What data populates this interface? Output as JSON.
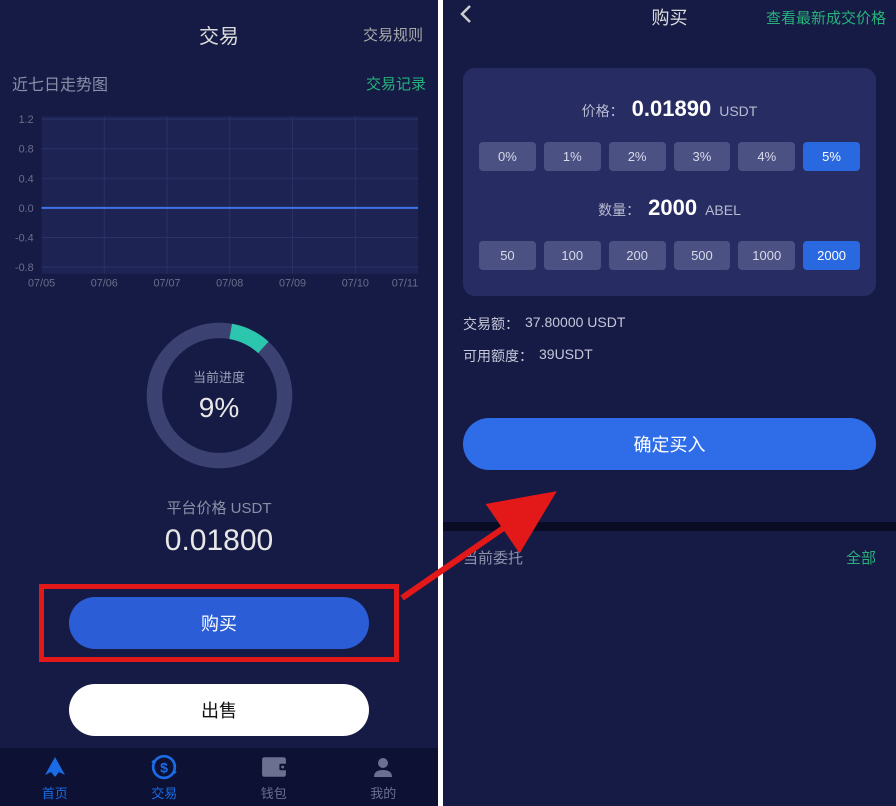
{
  "left": {
    "header": {
      "title": "交易",
      "rules": "交易规则"
    },
    "subheader": {
      "trend_label": "近七日走势图",
      "records": "交易记录"
    },
    "donut": {
      "label": "当前进度",
      "value": "9%"
    },
    "price": {
      "label": "平台价格 USDT",
      "value": "0.01800"
    },
    "buttons": {
      "buy": "购买",
      "sell": "出售"
    },
    "tabs": [
      "首页",
      "交易",
      "钱包",
      "我的"
    ]
  },
  "right": {
    "header": {
      "title": "购买",
      "link": "查看最新成交价格"
    },
    "price": {
      "label": "价格：",
      "value": "0.01890",
      "unit": "USDT"
    },
    "pct_options": [
      "0%",
      "1%",
      "2%",
      "3%",
      "4%",
      "5%"
    ],
    "pct_selected": 5,
    "qty": {
      "label": "数量：",
      "value": "2000",
      "unit": "ABEL"
    },
    "qty_options": [
      "50",
      "100",
      "200",
      "500",
      "1000",
      "2000"
    ],
    "qty_selected": 5,
    "info": {
      "amount_label": "交易额：",
      "amount_value": "37.80000 USDT",
      "balance_label": "可用额度：",
      "balance_value": "39USDT"
    },
    "confirm": "确定买入",
    "orders": {
      "title": "当前委托",
      "link": "全部"
    }
  },
  "chart_data": {
    "type": "line",
    "title": "近七日走势图",
    "x": [
      "07/05",
      "07/06",
      "07/07",
      "07/08",
      "07/09",
      "07/10",
      "07/11"
    ],
    "y_ticks": [
      -0.8,
      -0.4,
      0.0,
      0.4,
      0.8,
      1.2
    ],
    "values": [
      0,
      0,
      0,
      0,
      0,
      0,
      0
    ],
    "ylim": [
      -0.8,
      1.2
    ]
  },
  "donut_data": {
    "type": "pie",
    "values": [
      9,
      91
    ],
    "labels": [
      "progress",
      "remaining"
    ]
  }
}
